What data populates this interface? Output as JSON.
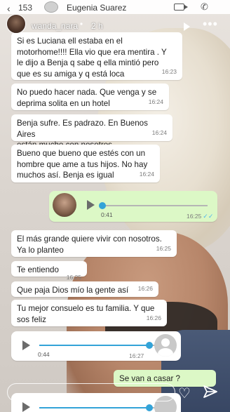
{
  "status_bar": {
    "back_glyph": "‹",
    "count": "153",
    "contact_name": "Eugenia Suarez"
  },
  "story": {
    "username": "wanda_nara",
    "time_ago": "2 h",
    "play_glyph": "▶",
    "more_glyph": "•••"
  },
  "messages": [
    {
      "text": "Si es Luciana ell estaba en el\nmotorhome!!!! Ella vio que era mentira . Y\nle dijo a Benja q sabe q ella mintió pero\nque es su amiga y q está loca",
      "time": "16:23"
    },
    {
      "text": "No puedo hacer nada. Que venga y se\ndeprima solita en un hotel",
      "time": "16:24"
    },
    {
      "text": "Benja sufre. Es padrazo. En Buenos Aires\nestán mucho con nosotros",
      "time": "16:24"
    },
    {
      "text": "Bueno que bueno que estés con un\nhombre que ame a tus hijos. No hay\nmuchos así. Benja es igual",
      "time": "16:24"
    },
    {
      "text": "El más grande quiere vivir con nosotros.\nYa lo planteo",
      "time": "16:25"
    },
    {
      "text": "Te entiendo",
      "time": "16:25"
    },
    {
      "text": "Que paja Dios mío la gente así",
      "time": "16:26"
    },
    {
      "text": "Tu mejor consuelo es tu familia. Y que\nsos feliz",
      "time": "16:26"
    }
  ],
  "voice_out": {
    "duration": "0:41",
    "time": "16:25",
    "ticks": "✓✓",
    "progress": 0.0
  },
  "voice_in_1": {
    "duration": "0:44",
    "time": "16:27",
    "progress": 0.95
  },
  "voice_in_2": {
    "progress": 0.95
  },
  "outgoing_last": {
    "text": "Se van a casar ?"
  },
  "icons": {
    "heart": "♡",
    "phone": "✆"
  },
  "colors": {
    "incoming_bubble": "#ffffff",
    "outgoing_bubble": "#dcf8c6",
    "voice_accent": "#33a3d8",
    "read_ticks": "#4fb6ec"
  }
}
